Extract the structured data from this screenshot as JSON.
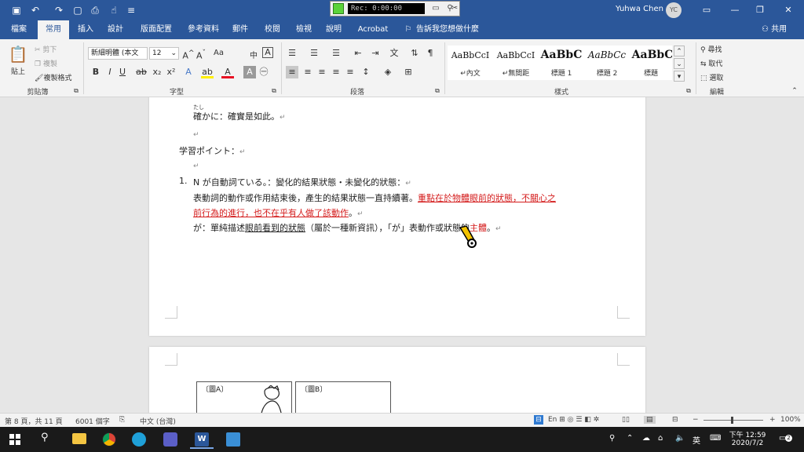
{
  "titlebar": {
    "recorder_time": "Rec: 0:00:00",
    "user_name": "Yuhwa Chen",
    "avatar_initials": "YC"
  },
  "tabs": [
    "檔案",
    "常用",
    "插入",
    "設計",
    "版面配置",
    "參考資料",
    "郵件",
    "校閱",
    "檢視",
    "說明",
    "Acrobat"
  ],
  "tell_me": "告訴我您想做什麼",
  "share": "共用",
  "ribbon": {
    "clipboard": {
      "paste": "貼上",
      "cut": "剪下",
      "copy": "複製",
      "format_painter": "複製格式",
      "label": "剪貼簿"
    },
    "font": {
      "name": "新細明體 (本文",
      "size": "12",
      "label": "字型",
      "change_case": "Aa",
      "phonetic": "中"
    },
    "paragraph": {
      "label": "段落"
    },
    "styles": {
      "label": "樣式",
      "items": [
        {
          "sample": "AaBbCcI",
          "name": "↵內文"
        },
        {
          "sample": "AaBbCcI",
          "name": "↵無間距"
        },
        {
          "sample": "AaBbC",
          "name": "標題 1"
        },
        {
          "sample": "AaBbCc",
          "name": "標題 2"
        },
        {
          "sample": "AaBbC",
          "name": "標題"
        }
      ]
    },
    "editing": {
      "find": "尋找",
      "replace": "取代",
      "select": "選取",
      "label": "編輯"
    }
  },
  "document": {
    "ruby": "たし",
    "line1": "確かに：確實是如此。",
    "line2": "学習ポイント：",
    "item_number": "1.",
    "item_heading": "N が自動詞ている。：變化的結果狀態・未變化的狀態：",
    "line3": "表動詞的動作或作用結束後，產生的結果狀態一直持續著。",
    "line3_red_a": "重點在於物體眼前的狀態，不關心之",
    "line4_red": "前行為的進行，也不在乎有人做了該動作",
    "line4_end": "。",
    "line5_a": "が：單純描述",
    "line5_ul": "眼前看到的狀態",
    "line5_b": "（屬於一種新資訊），「が」表動作或狀態的",
    "line5_red": "主體",
    "line5_end": "。",
    "para_mark": "↵",
    "fig_a": "〔圖A〕",
    "fig_b": "〔圖B〕"
  },
  "statusbar": {
    "page": "第 8 頁，共 11 頁",
    "words": "6001 個字",
    "language": "中文 (台灣)",
    "zoom": "100%"
  },
  "taskbar": {
    "ime": "英",
    "time": "下午 12:59",
    "date": "2020/7/2",
    "notifications": "2"
  },
  "colors": {
    "word_blue": "#2b579a",
    "accent_red": "#d41c1c"
  }
}
